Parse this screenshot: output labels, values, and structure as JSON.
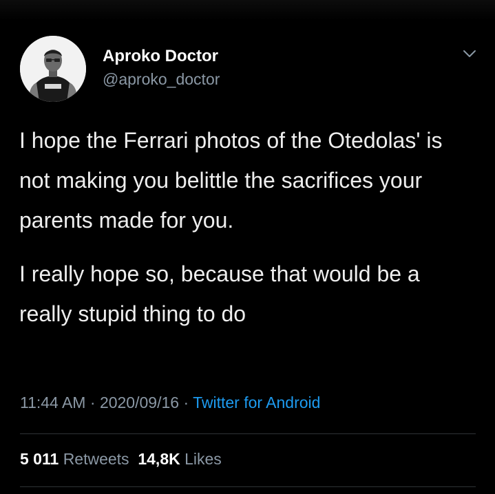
{
  "author": {
    "name": "Aproko Doctor",
    "handle": "@aproko_doctor",
    "avatar_icon": "profile-photo"
  },
  "tweet": {
    "paragraphs": [
      "I hope the Ferrari photos of the Otedolas' is not making you belittle the sacrifices your parents made for you.",
      "I really hope so, because that would be a really stupid thing to do"
    ]
  },
  "meta": {
    "time": "11:44 AM",
    "separator1": " · ",
    "date": "2020/09/16",
    "separator2": " · ",
    "source": "Twitter for Android"
  },
  "stats": {
    "retweets_count": "5 011",
    "retweets_label": "Retweets",
    "likes_count": "14,8K",
    "likes_label": "Likes"
  },
  "colors": {
    "background": "#000000",
    "text": "#eeeeee",
    "secondary": "#8b98a5",
    "link": "#1d9bf0"
  }
}
